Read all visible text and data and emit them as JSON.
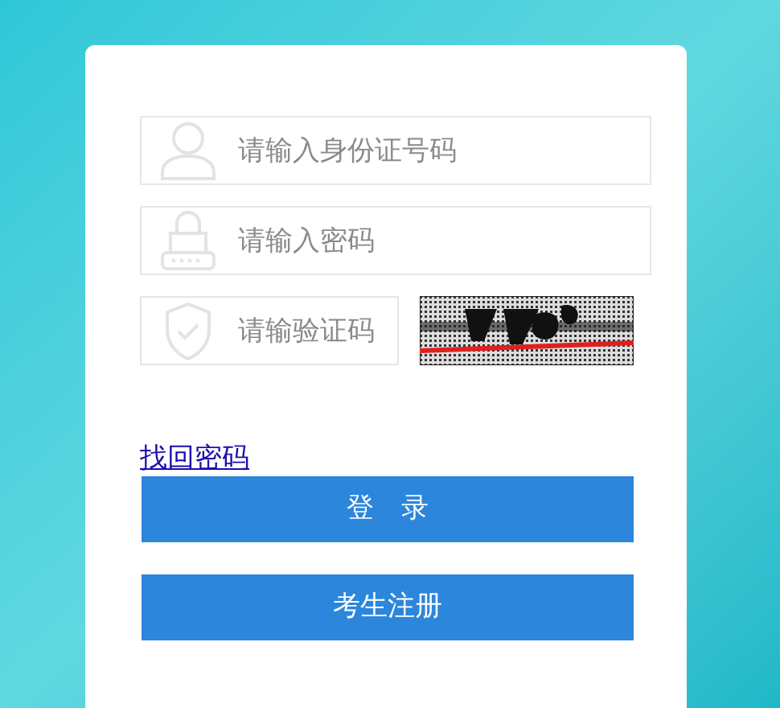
{
  "fields": [
    {
      "kind": "user",
      "placeholder": "请输入身份证号码"
    },
    {
      "kind": "lock",
      "placeholder": "请输入密码"
    }
  ],
  "captcha": {
    "placeholder": "请输验证码"
  },
  "forgot_link": "找回密码",
  "buttons": [
    "登　录",
    "考生注册"
  ]
}
